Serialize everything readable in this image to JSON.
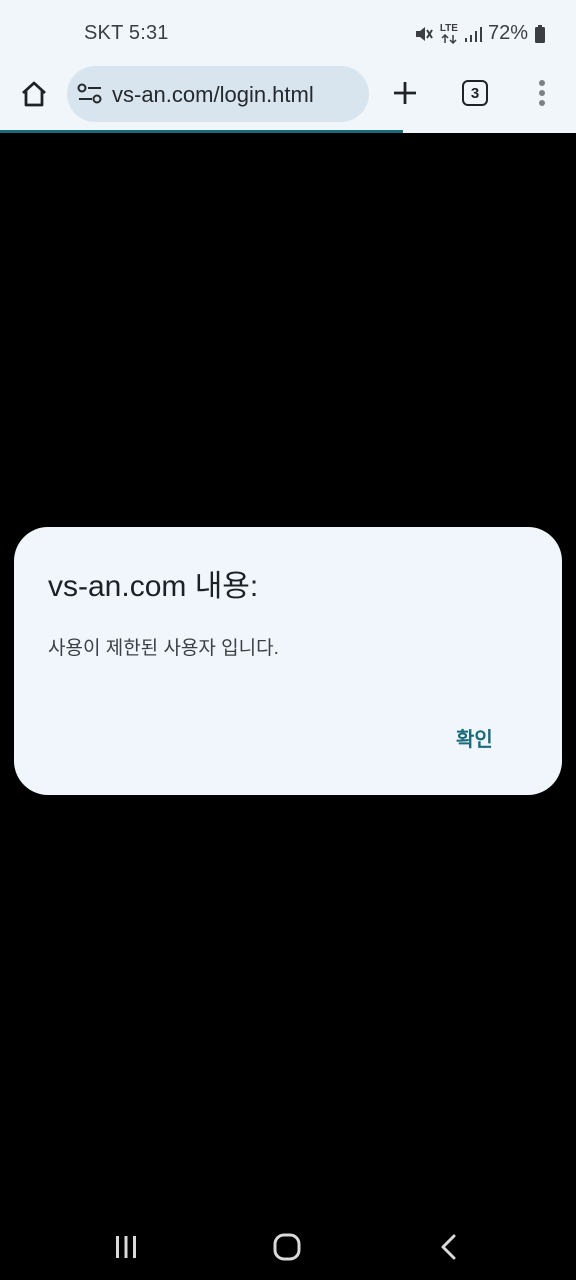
{
  "status_bar": {
    "carrier_time": "SKT 5:31",
    "network": "LTE",
    "battery": "72%",
    "icons": [
      "mute-icon",
      "lte-icon",
      "signal-icon",
      "battery-icon"
    ]
  },
  "browser": {
    "url": "vs-an.com/login.html",
    "tab_count": "3",
    "page_load_progress": 0.7,
    "accent_color": "#1b6c7a",
    "icons": [
      "home-icon",
      "site-settings-icon",
      "new-tab-icon",
      "tabs-icon",
      "more-menu-icon"
    ]
  },
  "dialog": {
    "title": "vs-an.com 내용:",
    "message": "사용이 제한된 사용자 입니다.",
    "ok_label": "확인"
  },
  "nav_bar": {
    "icons": [
      "recents-icon",
      "home-nav-icon",
      "back-icon"
    ]
  }
}
